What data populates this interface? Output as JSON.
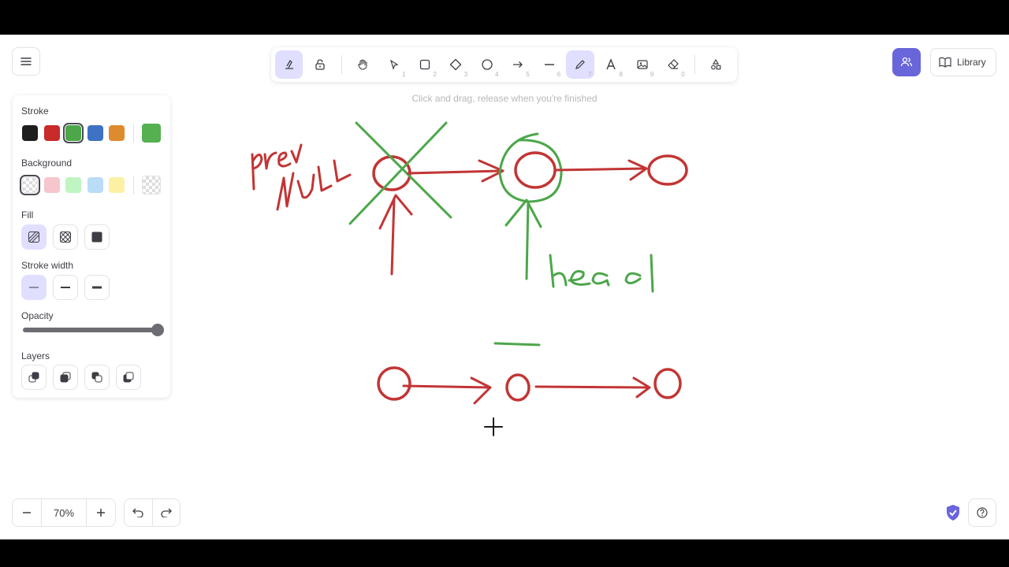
{
  "app": {
    "menu_icon": "hamburger-icon"
  },
  "toolbar": {
    "tools": [
      {
        "name": "tool-lock-keep",
        "icon": "keep-tool-icon",
        "key": "",
        "active": true
      },
      {
        "name": "tool-lock",
        "icon": "lock-open-icon",
        "key": ""
      },
      {
        "name": "tool-hand",
        "icon": "hand-icon",
        "key": ""
      },
      {
        "name": "tool-selection",
        "icon": "pointer-icon",
        "key": "1"
      },
      {
        "name": "tool-rectangle",
        "icon": "rectangle-icon",
        "key": "2"
      },
      {
        "name": "tool-diamond",
        "icon": "diamond-icon",
        "key": "3"
      },
      {
        "name": "tool-ellipse",
        "icon": "ellipse-icon",
        "key": "4"
      },
      {
        "name": "tool-arrow",
        "icon": "arrow-icon",
        "key": "5"
      },
      {
        "name": "tool-line",
        "icon": "line-icon",
        "key": "6"
      },
      {
        "name": "tool-draw",
        "icon": "pencil-icon",
        "key": "7",
        "active": true
      },
      {
        "name": "tool-text",
        "icon": "text-icon",
        "key": "8"
      },
      {
        "name": "tool-image",
        "icon": "image-icon",
        "key": "9"
      },
      {
        "name": "tool-eraser",
        "icon": "eraser-icon",
        "key": "0"
      },
      {
        "name": "tool-extra",
        "icon": "shapes-icon",
        "key": ""
      }
    ],
    "hint": "Click and drag, release when you're finished"
  },
  "panel": {
    "stroke_label": "Stroke",
    "stroke_colors": [
      "#1e1e1e",
      "#e03131",
      "#2f9e44",
      "#1971c2",
      "#f08c00"
    ],
    "stroke_selected": "#2f9e44",
    "stroke_current": "#40c057",
    "background_label": "Background",
    "background_colors": [
      "transparent",
      "#ffc9c9",
      "#b2f2bb",
      "#a5d8ff",
      "#ffec99"
    ],
    "fill_label": "Fill",
    "fill_options": [
      "hachure",
      "cross-hatch",
      "solid"
    ],
    "fill_selected": "hachure",
    "stroke_width_label": "Stroke width",
    "stroke_width_options": [
      "thin",
      "bold",
      "extra-bold"
    ],
    "stroke_width_selected": "thin",
    "opacity_label": "Opacity",
    "opacity_value": 100,
    "layers_label": "Layers",
    "layer_actions": [
      "send-to-back",
      "send-backward",
      "bring-forward",
      "bring-to-front"
    ]
  },
  "top_right": {
    "library_label": "Library",
    "collab_icon": "users-icon"
  },
  "footer": {
    "zoom_value": "70%",
    "zoom_out_icon": "minus-icon",
    "zoom_in_icon": "plus-icon",
    "undo_icon": "undo-icon",
    "redo_icon": "redo-icon",
    "help_icon": "question-icon",
    "shield_icon": "shield-check-icon"
  },
  "drawing": {
    "stroke_colors": {
      "red": "#c23535",
      "green": "#4ca64a"
    },
    "handwriting": [
      "prev",
      "NULL",
      "head"
    ]
  }
}
